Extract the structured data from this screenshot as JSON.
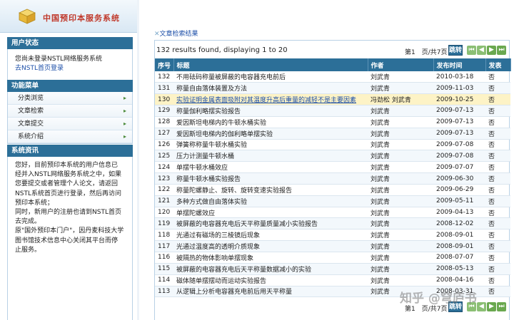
{
  "logo": {
    "text": "中国预印本服务系统"
  },
  "user_panel": {
    "title": "用户状态",
    "status_text": "您尚未登录NSTL网络服务系统",
    "link_text": "去NSTL首页登录"
  },
  "menu_panel": {
    "title": "功能菜单",
    "items": [
      {
        "label": "分类浏览"
      },
      {
        "label": "文章检索"
      },
      {
        "label": "文章提交"
      },
      {
        "label": "系统介绍"
      }
    ]
  },
  "info_panel": {
    "title": "系统资讯",
    "lines": [
      "您好，目前预印本系统的用户信息已",
      "经并入NSTL网络服务系统之中，如果",
      "您要提交或者管理个人论文，请返回",
      "NSTL系统首页进行登录，然后再访问",
      "预印本系统；",
      "同时，新用户的注册也请到NSTL首页",
      "去完成。",
      "原\"国外预印本门户\"，因丹麦科技大学",
      "图书馆技术信息中心关闭其平台而停",
      "止服务。"
    ]
  },
  "breadcrumb": {
    "cross": "✕",
    "text": "文章检索结果"
  },
  "pager": {
    "summary": "132 results found, displaying 1 to 20",
    "page_info": "第1　页/共7页",
    "jump_label": "跳转"
  },
  "table": {
    "headers": [
      "序号",
      "标题",
      "作者",
      "发布时间",
      "发表"
    ],
    "rows": [
      {
        "no": "132",
        "title": "不用砝码称量被屏蔽的电容器充电前后",
        "author": "刘武青",
        "date": "2010-03-18",
        "pub": "否"
      },
      {
        "no": "131",
        "title": "称量自由落体装置及方法",
        "author": "刘武青",
        "date": "2009-11-03",
        "pub": "否"
      },
      {
        "no": "130",
        "title": "实验证明金属表面吸附对其温度升高后重量的减轻不是主要因素",
        "author": "冯劲松 刘武青",
        "date": "2009-10-25",
        "pub": "否"
      },
      {
        "no": "129",
        "title": "称量伽利略摆实验报告",
        "author": "刘武青",
        "date": "2009-07-13",
        "pub": "否"
      },
      {
        "no": "128",
        "title": "爱因斯坦电梯内的牛顿水桶实验",
        "author": "刘武青",
        "date": "2009-07-13",
        "pub": "否"
      },
      {
        "no": "127",
        "title": "爱因斯坦电梯内的伽利略单摆实验",
        "author": "刘武青",
        "date": "2009-07-13",
        "pub": "否"
      },
      {
        "no": "126",
        "title": "弹簧称称量牛顿水桶实验",
        "author": "刘武青",
        "date": "2009-07-08",
        "pub": "否"
      },
      {
        "no": "125",
        "title": "压力计测量牛顿水桶",
        "author": "刘武青",
        "date": "2009-07-08",
        "pub": "否"
      },
      {
        "no": "124",
        "title": "单摆牛顿水桶效应",
        "author": "刘武青",
        "date": "2009-07-07",
        "pub": "否"
      },
      {
        "no": "123",
        "title": "称量牛顿水桶实验报告",
        "author": "刘武青",
        "date": "2009-06-30",
        "pub": "否"
      },
      {
        "no": "122",
        "title": "称量陀螺静止、旋转、旋转变速实验报告",
        "author": "刘武青",
        "date": "2009-06-29",
        "pub": "否"
      },
      {
        "no": "121",
        "title": "多种方式做自由落体实验",
        "author": "刘武青",
        "date": "2009-05-11",
        "pub": "否"
      },
      {
        "no": "120",
        "title": "单摆陀螺效应",
        "author": "刘武青",
        "date": "2009-04-13",
        "pub": "否"
      },
      {
        "no": "119",
        "title": "被屏蔽的电容器充电后天平称量质量减小实验报告",
        "author": "刘武青",
        "date": "2008-12-02",
        "pub": "否"
      },
      {
        "no": "118",
        "title": "光通过有磁场的三棱镜后现象",
        "author": "刘武青",
        "date": "2008-09-01",
        "pub": "否"
      },
      {
        "no": "117",
        "title": "光通过温度高的透明介质现象",
        "author": "刘武青",
        "date": "2008-09-01",
        "pub": "否"
      },
      {
        "no": "116",
        "title": "被隔热的物体影响单摆现象",
        "author": "刘武青",
        "date": "2008-07-07",
        "pub": "否"
      },
      {
        "no": "115",
        "title": "被屏蔽的电容器充电后天平称量数据减小的实验",
        "author": "刘武青",
        "date": "2008-05-13",
        "pub": "否"
      },
      {
        "no": "114",
        "title": "磁体随单摆摆动而运动实验报告",
        "author": "刘武青",
        "date": "2008-04-16",
        "pub": "否"
      },
      {
        "no": "113",
        "title": "从逻辑上分析电容器充电前后用天平称量",
        "author": "刘武青",
        "date": "2008-03-31",
        "pub": "否"
      }
    ],
    "highlight_row_index": 2
  },
  "watermark": {
    "text": "知乎 @穹庐书"
  },
  "colors": {
    "header_blue": "#2c6f98",
    "highlight_row": "#fdf3c6",
    "link_blue": "#1d4fa8",
    "logo_red": "#c0392b"
  },
  "icons": {
    "logo": "cube-icon",
    "nav_first": "first-page-icon",
    "nav_prev": "prev-page-icon",
    "nav_next": "next-page-icon",
    "nav_last": "last-page-icon",
    "menu_arrow": "chevron-right-icon"
  }
}
